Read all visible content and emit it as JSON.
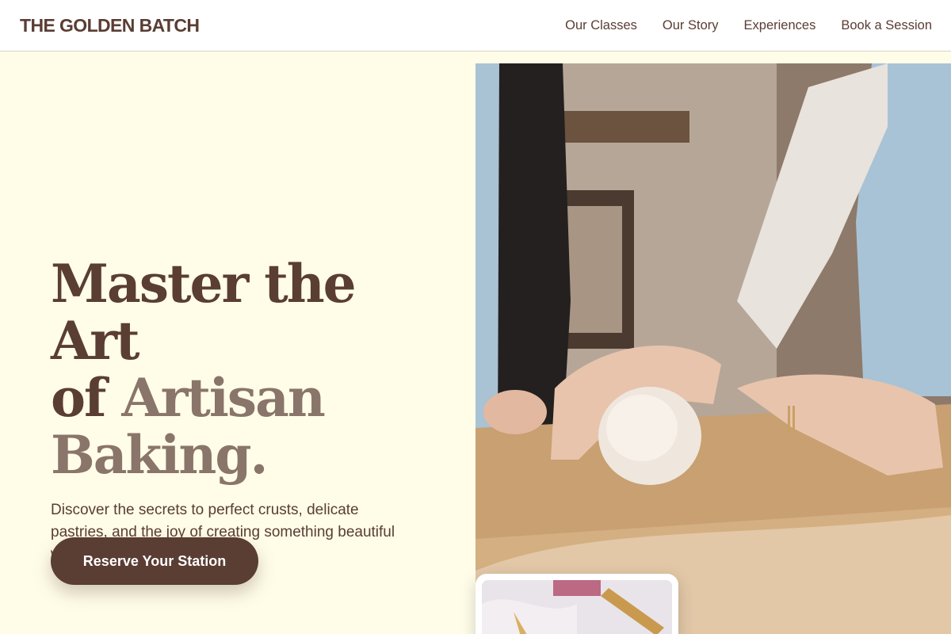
{
  "brand": {
    "name": "THE GOLDEN BATCH"
  },
  "nav": {
    "items": [
      "Our Classes",
      "Our Story",
      "Experiences",
      "Book a Session"
    ]
  },
  "hero": {
    "headline_line1": "Master the Art",
    "headline_line2_a": "of ",
    "headline_line2_b": "Artisan",
    "headline_line3": "Baking.",
    "subtext": "Discover the secrets to perfect crusts, delicate pastries, and the joy of creating something beautiful with your own hands.",
    "cta_label": "Reserve Your Station"
  },
  "colors": {
    "background": "#fffde8",
    "primary": "#5a3d33",
    "muted": "#8a756a"
  }
}
